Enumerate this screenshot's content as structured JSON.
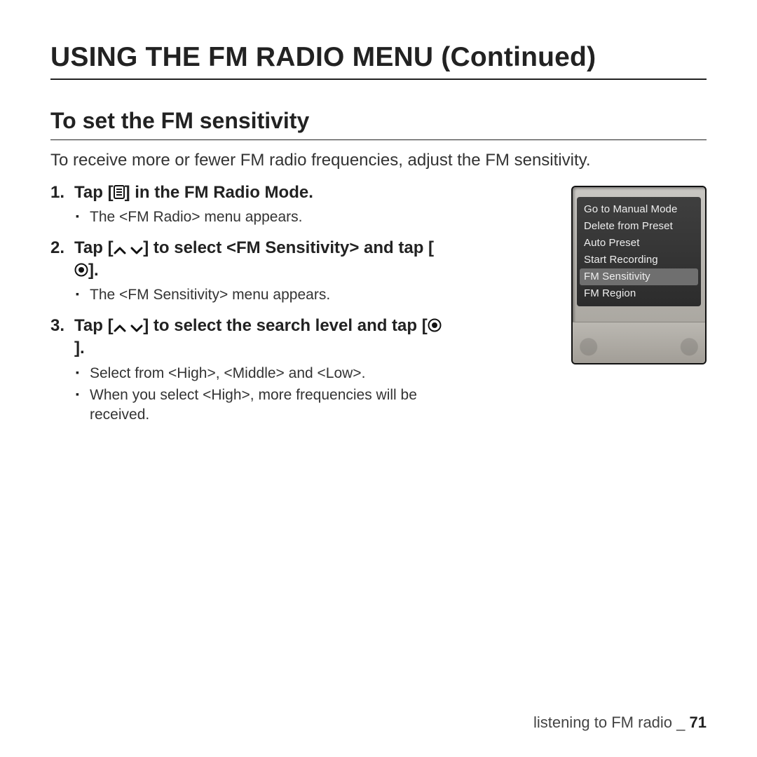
{
  "title": "USING THE FM RADIO MENU (Continued)",
  "section_title": "To set the FM sensitivity",
  "intro": "To receive more or fewer FM radio frequencies, adjust the FM sensitivity.",
  "steps": [
    {
      "pre": "Tap ",
      "icon": "menu",
      "mid": "",
      "post": " in the FM Radio Mode.",
      "subs": [
        "The <FM Radio> menu appears."
      ]
    },
    {
      "pre": "Tap ",
      "icon": "updown",
      "mid_plain": " to select ",
      "mid_strong": "<FM Sensitivity>",
      "post_plain": " and tap ",
      "icon2": "target",
      "tail": ".",
      "subs": [
        "The <FM Sensitivity> menu appears."
      ]
    },
    {
      "pre": "Tap ",
      "icon": "updown",
      "mid": " to select the search level and tap ",
      "icon2": "target",
      "tail": ".",
      "subs": [
        "Select from <High>, <Middle> and <Low>.",
        "When you select <High>, more frequencies will be received."
      ]
    }
  ],
  "device_menu": {
    "items": [
      {
        "label": "Go to Manual Mode",
        "highlighted": false
      },
      {
        "label": "Delete from Preset",
        "highlighted": false
      },
      {
        "label": "Auto Preset",
        "highlighted": false
      },
      {
        "label": "Start Recording",
        "highlighted": false
      },
      {
        "label": "FM Sensitivity",
        "highlighted": true
      },
      {
        "label": "FM Region",
        "highlighted": false
      }
    ]
  },
  "footer": {
    "chapter": "listening to FM radio",
    "sep": " _ ",
    "page": "71"
  }
}
